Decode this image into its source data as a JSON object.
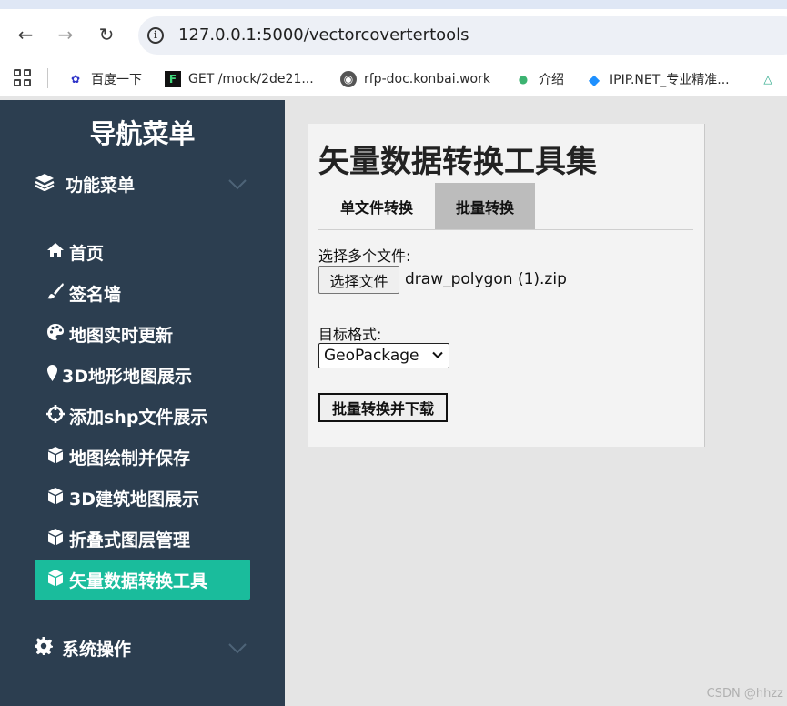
{
  "browser": {
    "url": "127.0.0.1:5000/vectorcovertertools",
    "bookmarks": [
      {
        "label": "百度一下",
        "icon": "baidu-paw-icon"
      },
      {
        "label": "GET /mock/2de21...",
        "icon": "f-logo-icon"
      },
      {
        "label": "rfp-doc.konbai.work",
        "icon": "globe-icon"
      },
      {
        "label": "介绍",
        "icon": "leaf-icon"
      },
      {
        "label": "IPIP.NET_专业精准...",
        "icon": "ipip-diamond-icon"
      }
    ]
  },
  "sidebar": {
    "title": "导航菜单",
    "group_function": "功能菜单",
    "items": [
      {
        "label": "首页",
        "icon": "home-icon"
      },
      {
        "label": "签名墙",
        "icon": "brush-icon"
      },
      {
        "label": "地图实时更新",
        "icon": "palette-icon"
      },
      {
        "label": "3D地形地图展示",
        "icon": "map-marker-icon"
      },
      {
        "label": "添加shp文件展示",
        "icon": "crosshair-icon"
      },
      {
        "label": "地图绘制并保存",
        "icon": "cube-icon"
      },
      {
        "label": "3D建筑地图展示",
        "icon": "cube-icon"
      },
      {
        "label": "折叠式图层管理",
        "icon": "cube-icon"
      },
      {
        "label": "矢量数据转换工具",
        "icon": "cube-icon",
        "active": true
      }
    ],
    "group_system": "系统操作",
    "colors": {
      "background": "#2c3e50",
      "active": "#1abc9c"
    }
  },
  "main": {
    "title": "矢量数据转换工具集",
    "tabs": [
      {
        "label": "单文件转换",
        "active": false
      },
      {
        "label": "批量转换",
        "active": true
      }
    ],
    "file_label": "选择多个文件:",
    "file_button": "选择文件",
    "file_name": "draw_polygon (1).zip",
    "format_label": "目标格式:",
    "format_selected": "GeoPackage",
    "submit_label": "批量转换并下载"
  },
  "watermark": "CSDN @hhzz"
}
